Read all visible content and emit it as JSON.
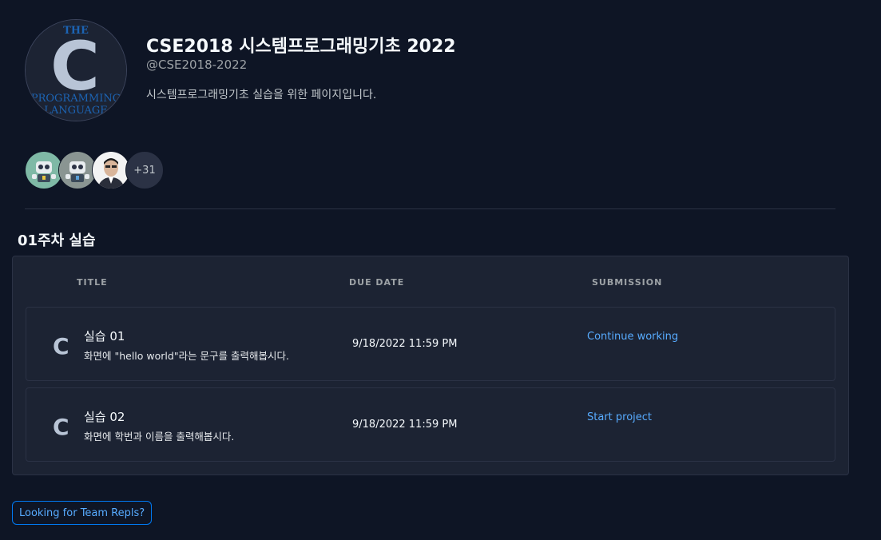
{
  "team": {
    "logo_text_top": "THE",
    "logo_letter": "C",
    "logo_text_mid": "PROGRAMMING",
    "logo_text_bottom": "LANGUAGE",
    "name": "CSE2018 시스템프로그래밍기초 2022",
    "handle": "@CSE2018-2022",
    "description": "시스템프로그래밍기초 실습을 위한 페이지입니다."
  },
  "members": {
    "avatars": [
      "robot-avatar-icon",
      "robot-avatar-icon",
      "person-avatar"
    ],
    "more_count": "+31"
  },
  "section": {
    "title": "01주차 실습"
  },
  "table": {
    "columns": [
      "TITLE",
      "DUE DATE",
      "SUBMISSION"
    ],
    "rows": [
      {
        "icon": "C",
        "title": "실습 01",
        "description": "화면에 \"hello world\"라는 문구를 출력해봅시다.",
        "due": "9/18/2022 11:59 PM",
        "action": "Continue working"
      },
      {
        "icon": "C",
        "title": "실습 02",
        "description": "화면에 학번과 이름을 출력해봅시다.",
        "due": "9/18/2022 11:59 PM",
        "action": "Start project"
      }
    ]
  },
  "footer": {
    "team_repls_label": "Looking for Team Repls?"
  },
  "colors": {
    "background": "#0e1525",
    "panel": "#1c2333",
    "link": "#57abff",
    "logo_blue": "#1c64b4"
  }
}
